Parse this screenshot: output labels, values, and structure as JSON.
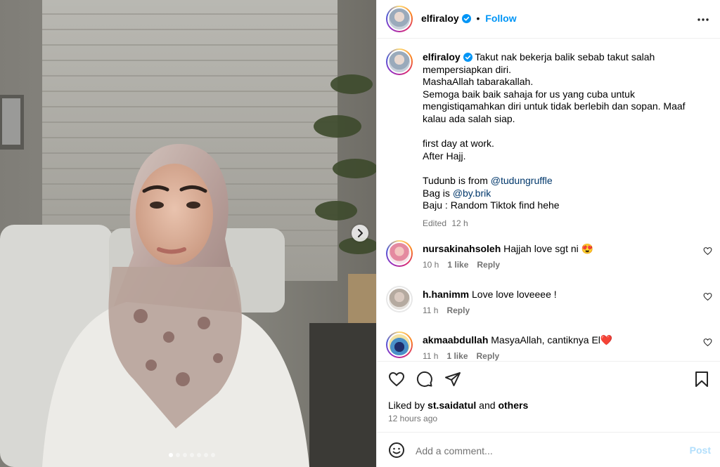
{
  "post": {
    "username": "elfiraloy",
    "follow_label": "Follow",
    "separator": "•",
    "caption": "Takut nak bekerja balik sebab takut salah mempersiapkan diri.\nMashaAllah tabarakallah.\nSemoga baik baik sahaja for us yang cuba untuk mengistiqamahkan diri untuk tidak berlebih dan sopan. Maaf kalau ada salah siap.\n\nfirst day at work.\nAfter Hajj.\n\nTudunb is from ",
    "mention_tudung": "@tudungruffle",
    "bag_prefix": "Bag is ",
    "mention_bag": "@by.brik",
    "baju_line": "Baju : Random Tiktok find hehe",
    "edited_label": "Edited",
    "caption_time": "12 h"
  },
  "comments": [
    {
      "username": "nursakinahsoleh",
      "text": "Hajjah love sgt ni 😍",
      "time": "10 h",
      "likes": "1 like",
      "reply": "Reply"
    },
    {
      "username": "h.hanimm",
      "text": "Love love loveeee !",
      "time": "11 h",
      "likes": "",
      "reply": "Reply"
    },
    {
      "username": "akmaabdullah",
      "text": "MasyaAllah, cantiknya El❤️",
      "time": "11 h",
      "likes": "1 like",
      "reply": "Reply"
    }
  ],
  "likes_bar": {
    "liked_by_prefix": "Liked by ",
    "liked_by_user": "st.saidatul",
    "and_label": " and ",
    "others_label": "others",
    "time_ago": "12 hours ago"
  },
  "add_comment": {
    "placeholder": "Add a comment...",
    "post_label": "Post"
  },
  "carousel": {
    "count": 7,
    "active_index": 0
  },
  "colors": {
    "accent": "#0095f6",
    "link": "#00376b",
    "muted": "#737373",
    "verified": "#0095f6",
    "post_disabled": "#b2dffc"
  }
}
